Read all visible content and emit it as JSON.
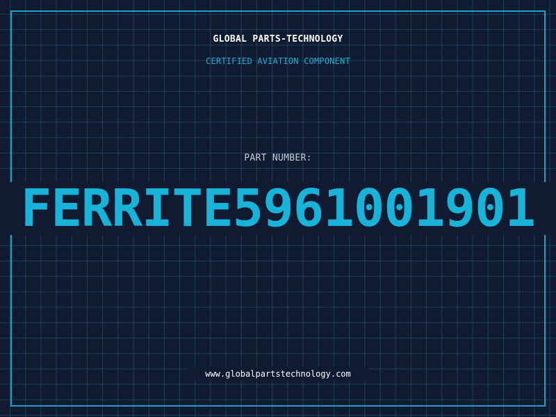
{
  "header": {
    "company": "GLOBAL PARTS-TECHNOLOGY",
    "subtitle": "CERTIFIED AVIATION COMPONENT"
  },
  "part": {
    "label": "PART NUMBER:",
    "number": "FERRITE5961001901"
  },
  "footer": {
    "url": "www.globalpartstechnology.com"
  },
  "colors": {
    "background": "#101a30",
    "grid": "#288caa",
    "accent": "#18a3c8",
    "text_primary": "#ffffff",
    "text_muted": "#c6cdd6"
  }
}
